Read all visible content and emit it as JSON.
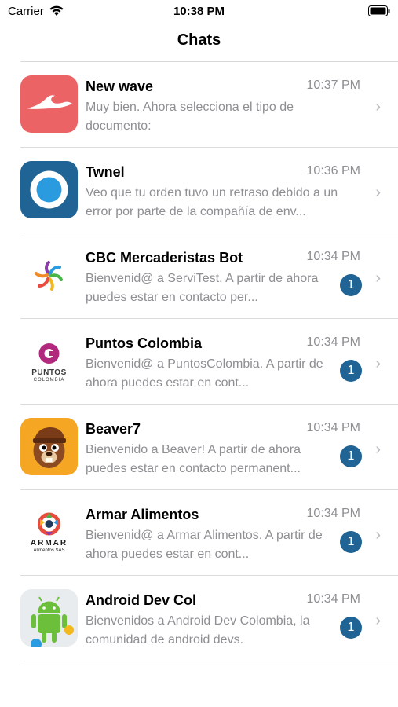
{
  "status_bar": {
    "carrier": "Carrier",
    "time": "10:38 PM"
  },
  "header": {
    "title": "Chats"
  },
  "colors": {
    "badge": "#1f6494",
    "divider": "#dcdcdc",
    "secondary_text": "#8e8e93"
  },
  "chats": [
    {
      "name": "New wave",
      "time": "10:37 PM",
      "preview": "Muy bien.  Ahora selecciona el tipo de documento:",
      "unread": "",
      "icon": "new-wave-logo-icon"
    },
    {
      "name": "Twnel",
      "time": "10:36 PM",
      "preview": "Veo que tu orden tuvo un retraso debido a un error por parte de la compañía de env...",
      "unread": "",
      "icon": "twnel-logo-icon"
    },
    {
      "name": "CBC Mercaderistas Bot",
      "time": "10:34 PM",
      "preview": "Bienvenid@ a ServiTest.  A partir de ahora puedes estar en contacto per...",
      "unread": "1",
      "icon": "cbc-logo-icon"
    },
    {
      "name": "Puntos Colombia",
      "time": "10:34 PM",
      "preview": "Bienvenid@ a PuntosColombia.  A partir de ahora puedes estar en cont...",
      "unread": "1",
      "icon": "puntos-colombia-logo-icon"
    },
    {
      "name": "Beaver7",
      "time": "10:34 PM",
      "preview": "Bienvenido a Beaver!  A partir de ahora puedes estar en contacto permanent...",
      "unread": "1",
      "icon": "beaver-logo-icon"
    },
    {
      "name": "Armar Alimentos",
      "time": "10:34 PM",
      "preview": "Bienvenid@ a Armar Alimentos.  A partir de ahora puedes estar en cont...",
      "unread": "1",
      "icon": "armar-logo-icon"
    },
    {
      "name": "Android Dev Col",
      "time": "10:34 PM",
      "preview": "Bienvenidos a Android Dev Colombia, la comunidad de android devs.",
      "unread": "1",
      "icon": "android-logo-icon"
    }
  ],
  "logos": {
    "puntos": "PUNTOS",
    "puntos_sub": "COLOMBIA",
    "armar": "ARMAR",
    "armar_sub": "Alimentos SAS"
  }
}
